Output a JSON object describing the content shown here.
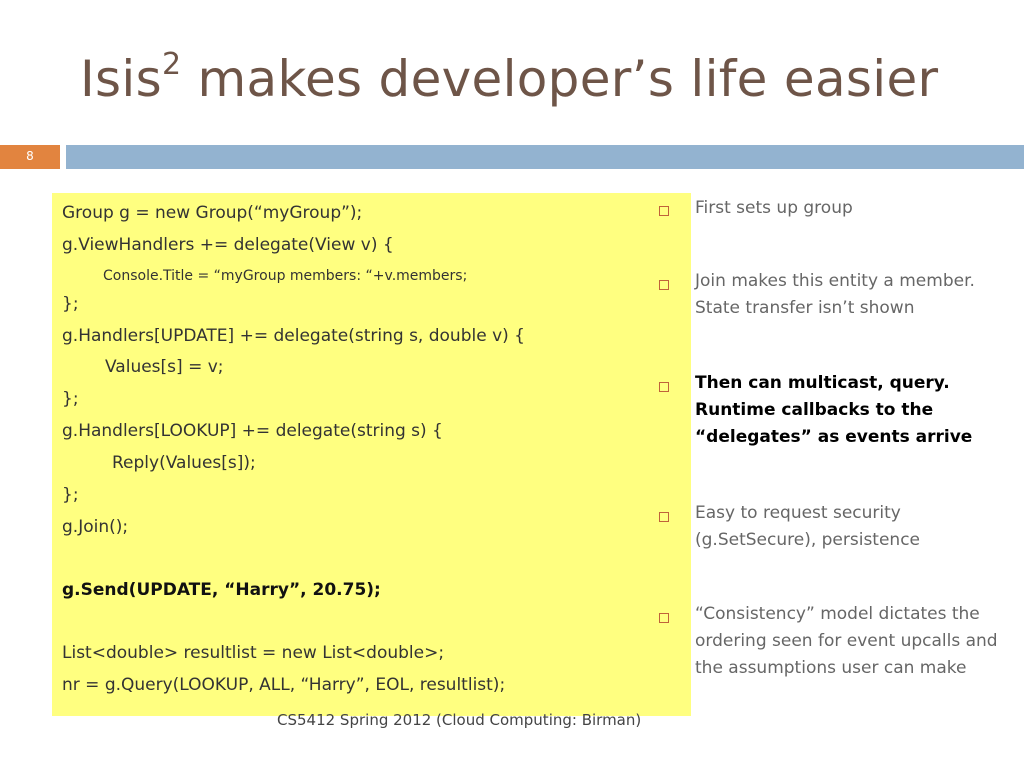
{
  "slide": {
    "title_main": "Isis",
    "title_sup": "2",
    "title_rest": " makes developer’s life easier",
    "number": "8",
    "footer": "CS5412 Spring 2012 (Cloud Computing: Birman)"
  },
  "code": [
    "Group g = new Group(“myGroup”);",
    "g.ViewHandlers += delegate(View v) {",
    "Console.Title = “myGroup members: “+v.members;",
    "};",
    "g.Handlers[UPDATE] += delegate(string s, double v) {",
    "Values[s] = v;",
    "};",
    "g.Handlers[LOOKUP] += delegate(string s) {",
    "Reply(Values[s]);",
    "};",
    "g.Join();",
    "g.Send(UPDATE, “Harry”, 20.75);",
    "List<double> resultlist = new List<double>;",
    "nr = g.Query(LOOKUP, ALL, “Harry”, EOL, resultlist);"
  ],
  "bullets": [
    "First sets up group",
    "Join makes this entity a member. State transfer isn’t shown",
    "Then can multicast, query. Runtime callbacks to the “delegates” as events arrive",
    "Easy to request security (g.SetSecure), persistence",
    "“Consistency” model dictates the ordering seen for event upcalls and the assumptions user can make"
  ],
  "colors": {
    "title": "#6e5548",
    "accent_orange": "#e2843f",
    "accent_blue": "#93b3d0",
    "code_background": "#ffff80"
  }
}
